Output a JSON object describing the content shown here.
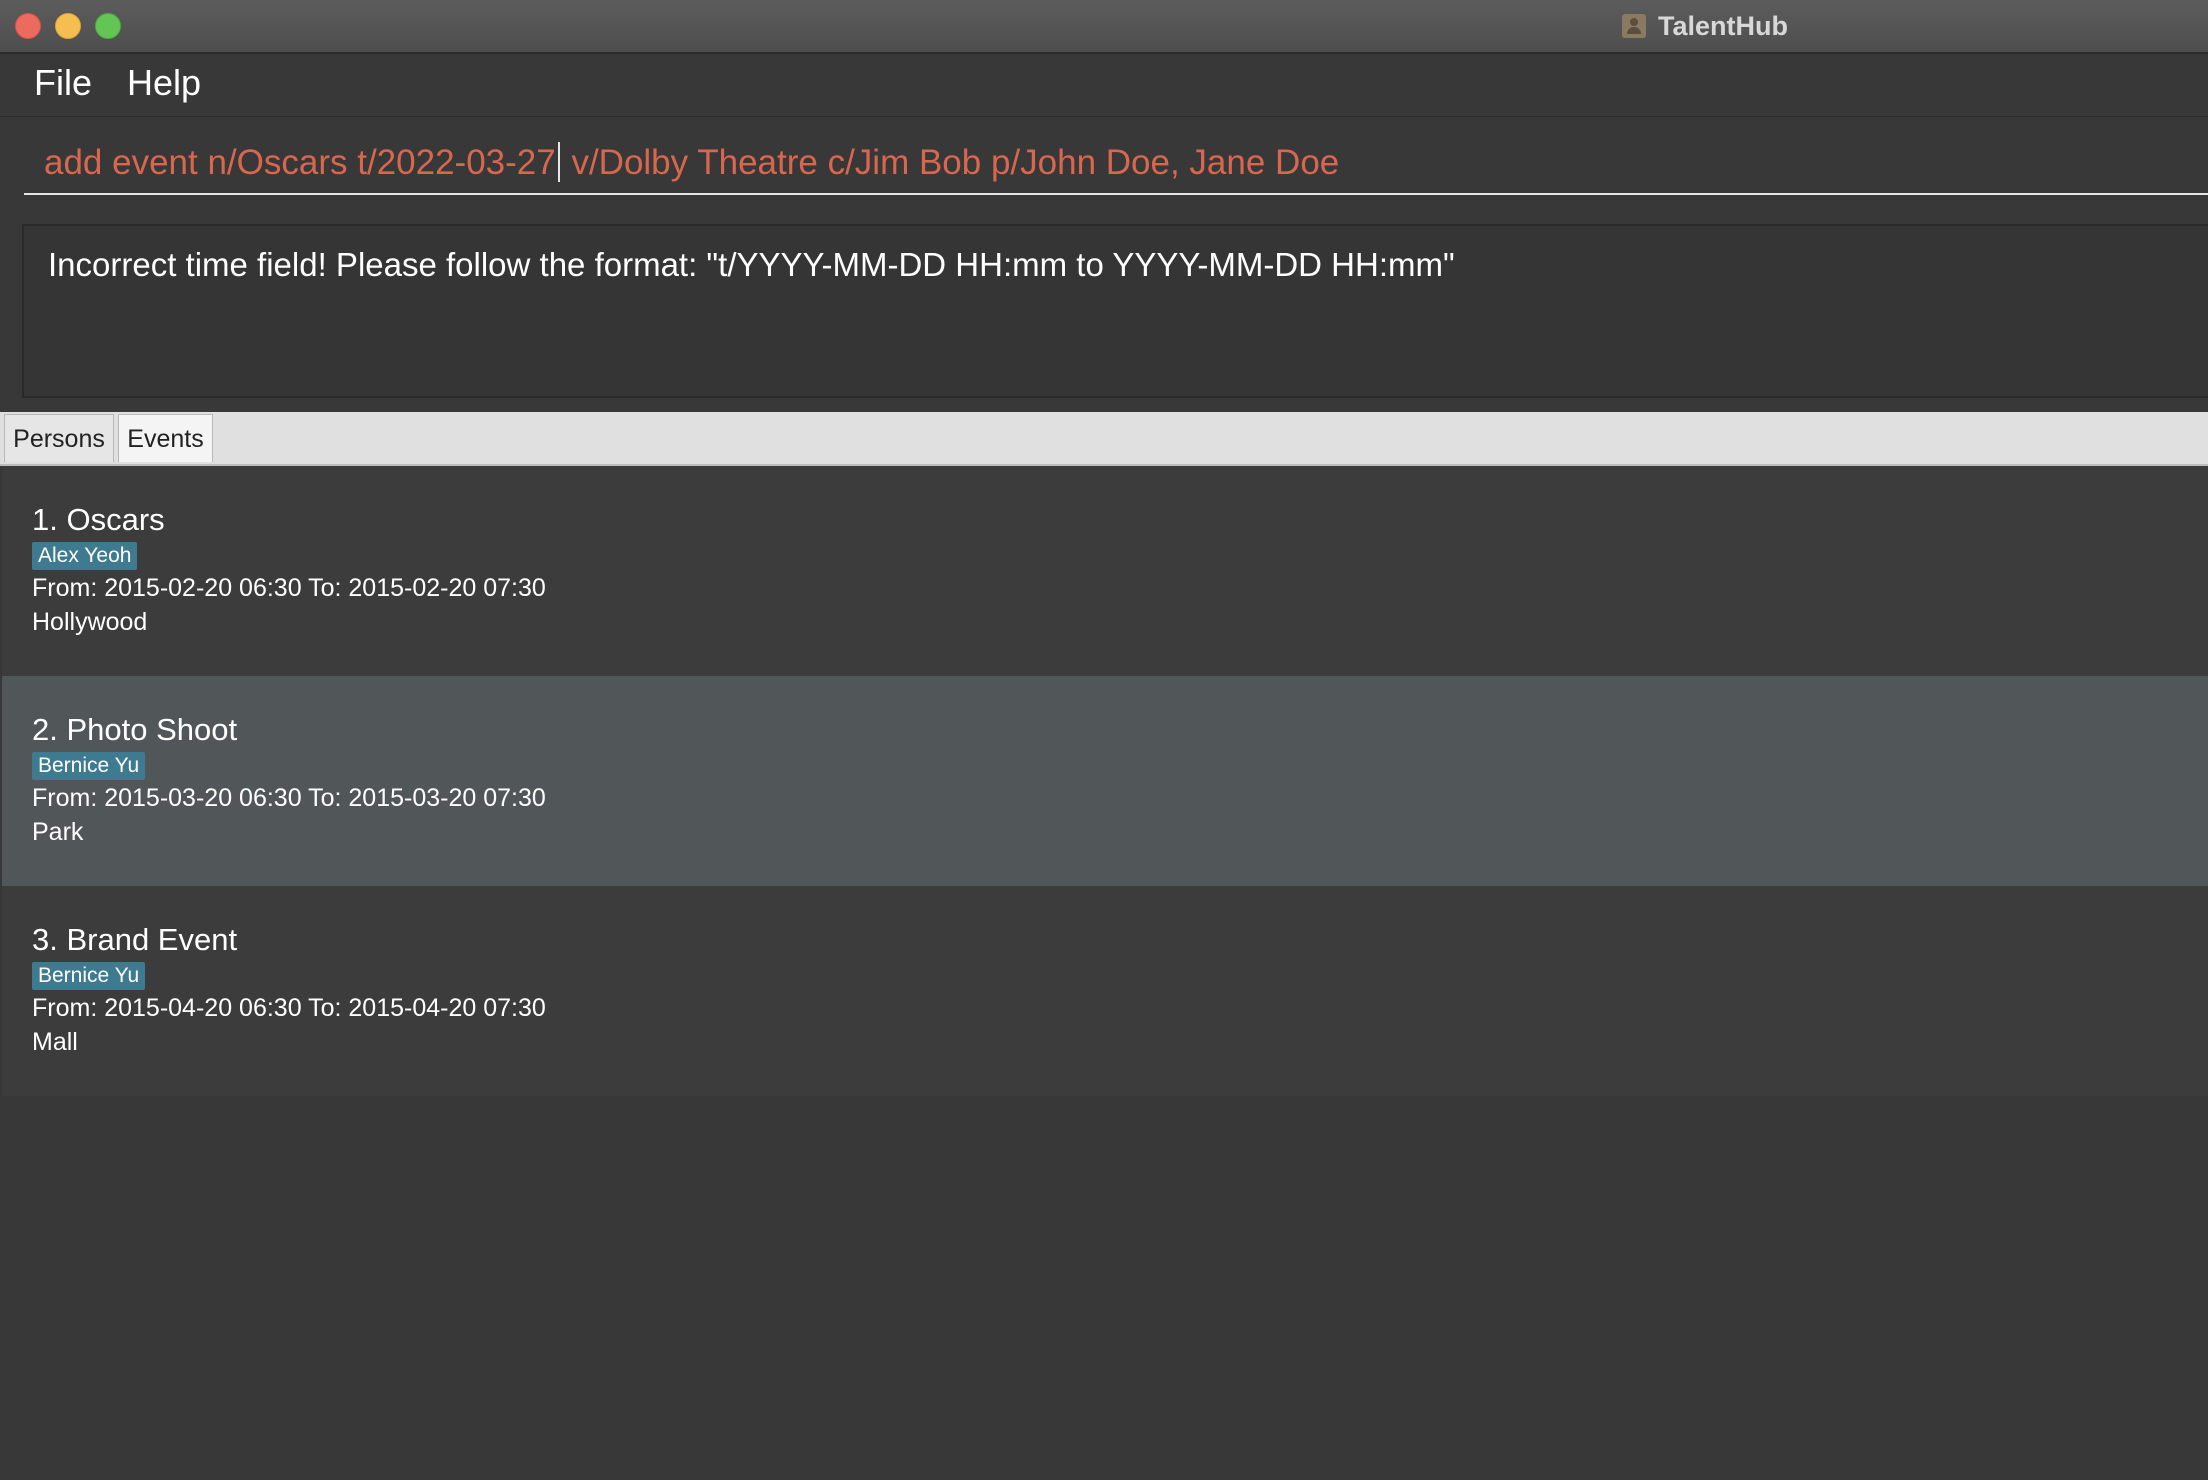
{
  "window": {
    "title": "TalentHub"
  },
  "menu": {
    "file": "File",
    "help": "Help"
  },
  "command": {
    "text_before_caret": "add event n/Oscars t/2022-03-27",
    "text_after_caret": " v/Dolby Theatre c/Jim Bob p/John Doe, Jane Doe",
    "color": "#d7674f"
  },
  "result": {
    "message": "Incorrect time field! Please follow the format: \"t/YYYY-MM-DD HH:mm to YYYY-MM-DD HH:mm\""
  },
  "tabs": [
    {
      "label": "Persons",
      "selected": false
    },
    {
      "label": "Events",
      "selected": true
    }
  ],
  "events": [
    {
      "title": "1. Oscars",
      "tag": "Alex Yeoh",
      "time": "From: 2015-02-20 06:30 To: 2015-02-20 07:30",
      "venue": "Hollywood"
    },
    {
      "title": "2. Photo Shoot",
      "tag": "Bernice Yu",
      "time": "From: 2015-03-20 06:30 To: 2015-03-20 07:30",
      "venue": "Park"
    },
    {
      "title": "3. Brand Event",
      "tag": "Bernice Yu",
      "time": "From: 2015-04-20 06:30 To: 2015-04-20 07:30",
      "venue": "Mall"
    }
  ],
  "colors": {
    "tag_background": "#3e7b91",
    "selected_row": "#515658"
  }
}
